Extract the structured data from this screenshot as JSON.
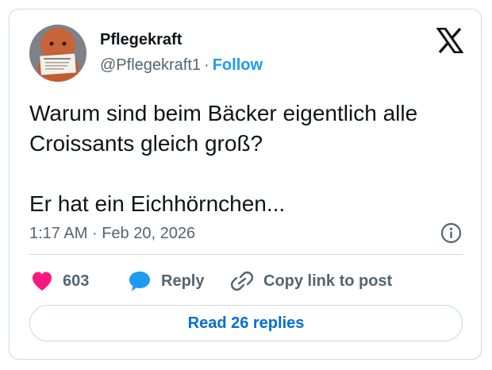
{
  "author": {
    "name": "Pflegekraft",
    "handle": "@Pflegekraft1",
    "separator": "·",
    "follow_label": "Follow"
  },
  "tweet": {
    "line1": "Warum sind beim Bäcker eigentlich alle",
    "line2": "Croissants gleich groß?",
    "line3": "Er hat ein Eichhörnchen...",
    "time": "1:17 AM",
    "time_separator": "·",
    "date": "Feb 20, 2026"
  },
  "actions": {
    "like_count": "603",
    "reply_label": "Reply",
    "copy_label": "Copy link to post"
  },
  "read_replies_label": "Read 26 replies",
  "colors": {
    "accent": "#1d9bf0",
    "link_blue": "#006fd6",
    "like_pink": "#f91880",
    "reply_blue": "#1d9bf0",
    "muted": "#536471",
    "border": "#cfd9de"
  },
  "icons": {
    "logo": "x-logo-icon",
    "info": "info-icon",
    "like": "heart-icon",
    "reply": "speech-bubble-icon",
    "copy": "link-icon"
  }
}
